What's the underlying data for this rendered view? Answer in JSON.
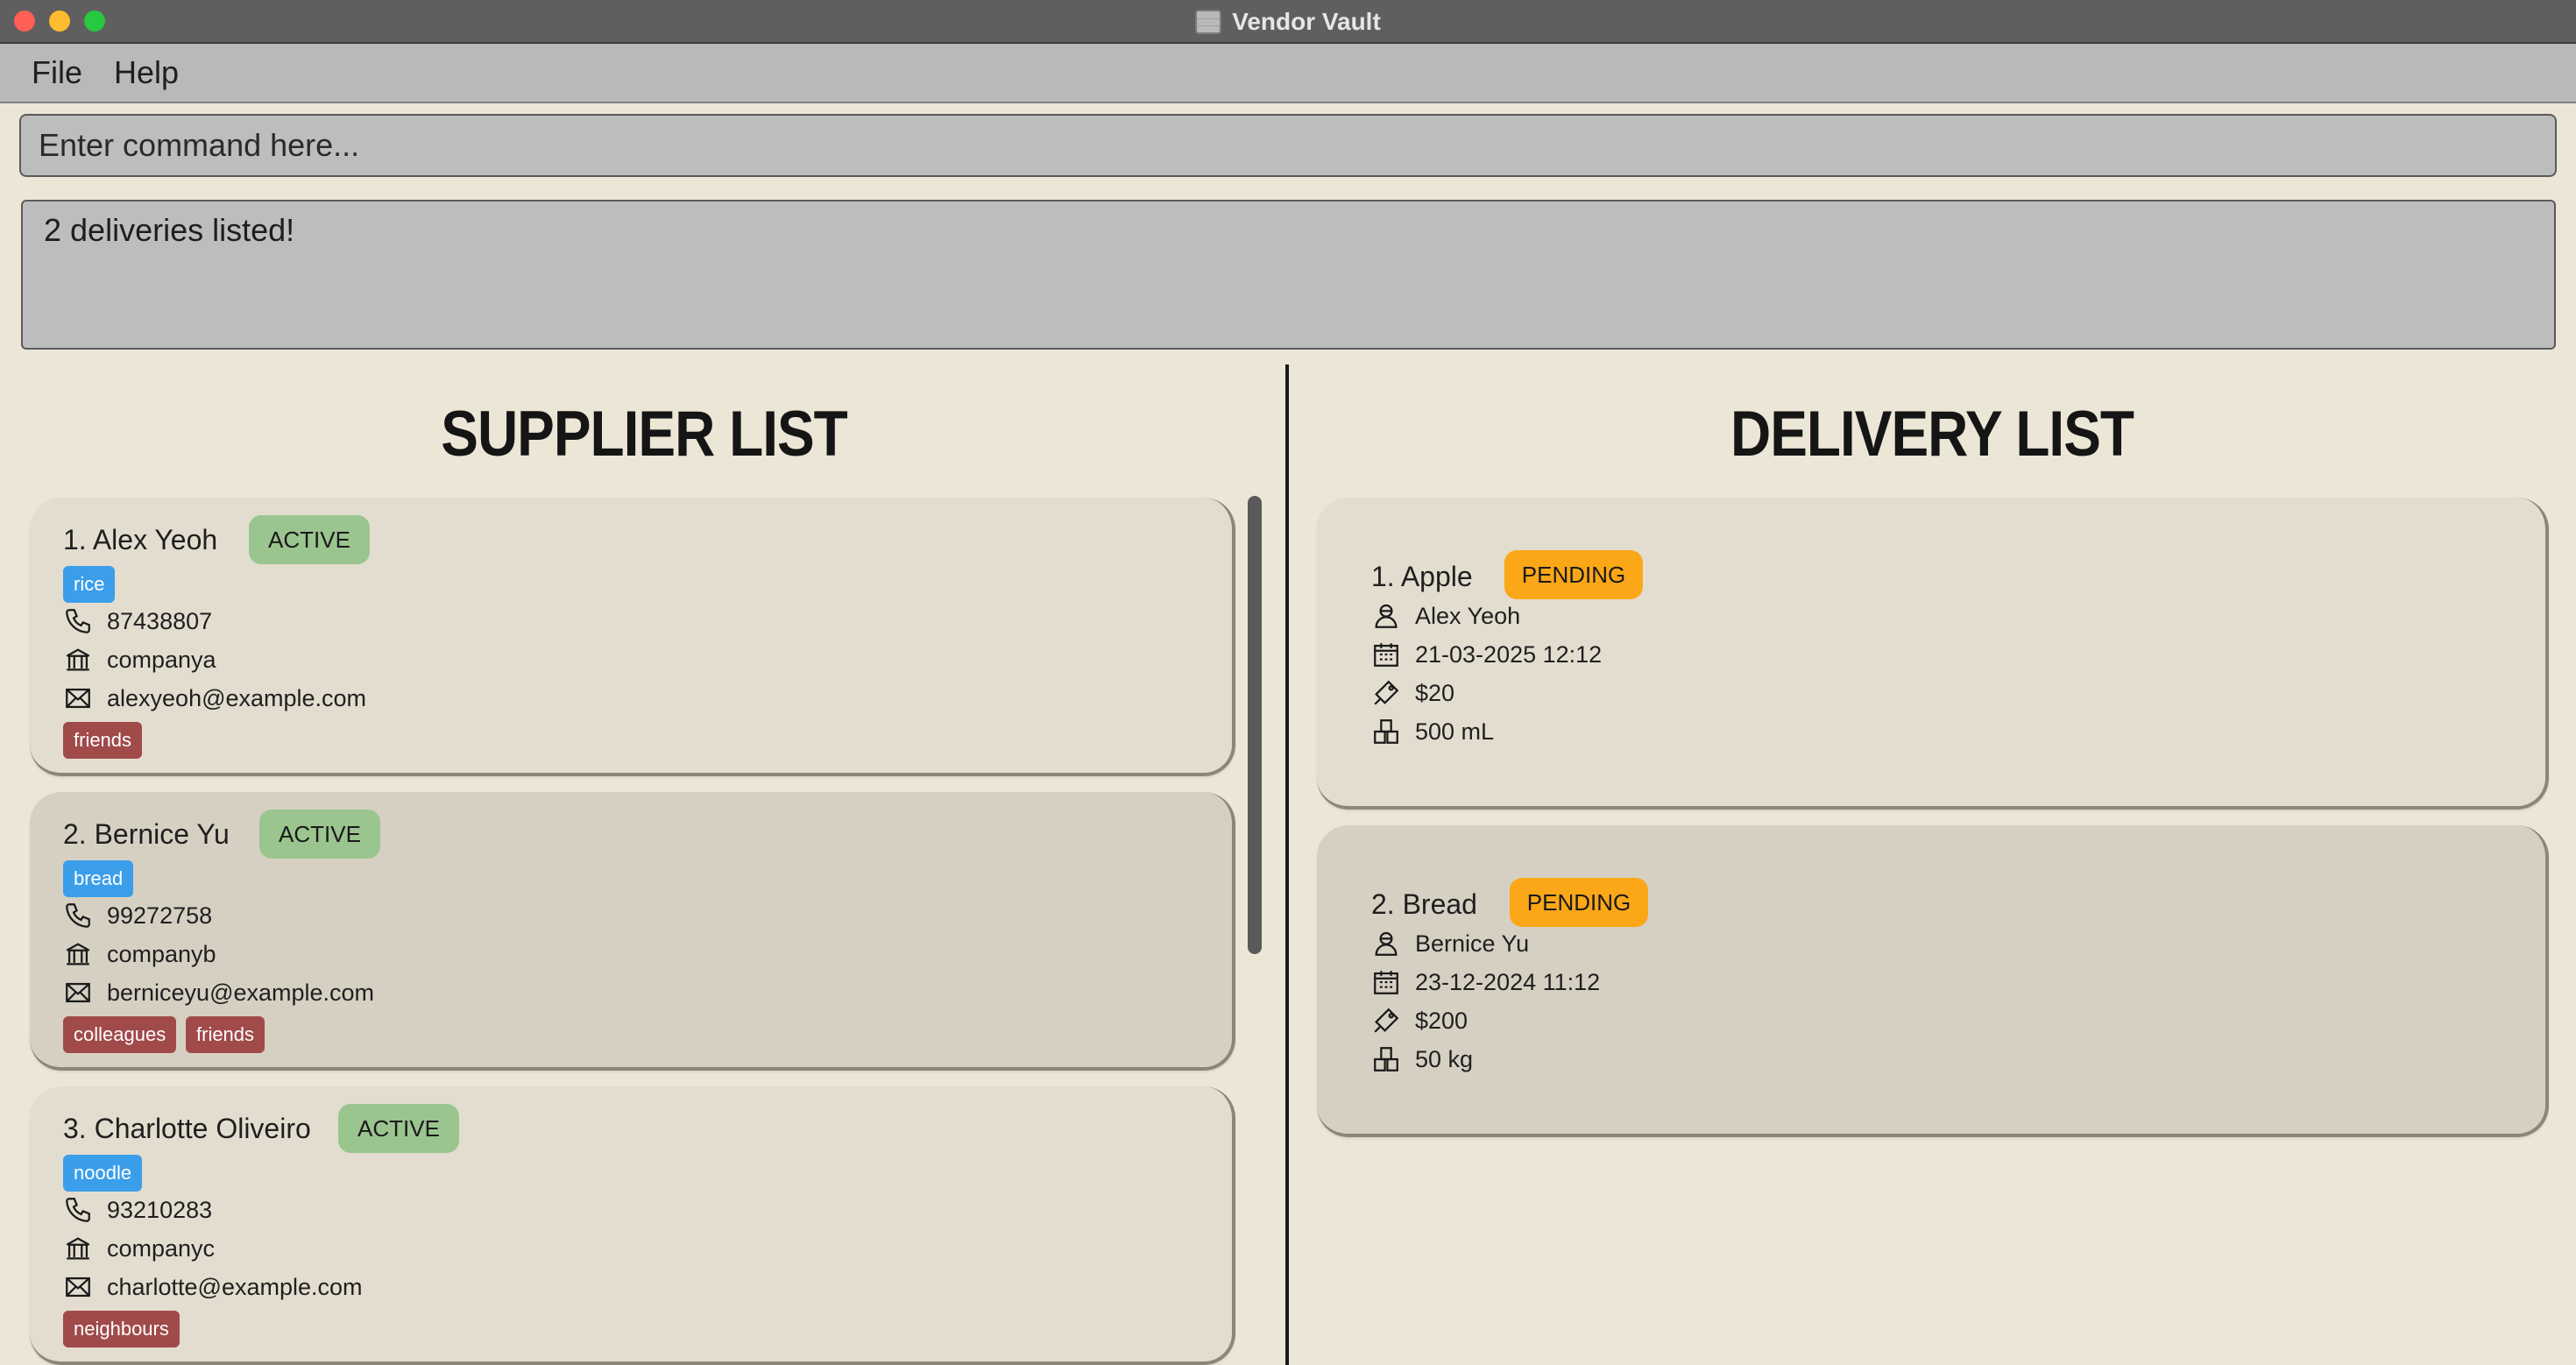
{
  "window": {
    "title": "Vendor Vault"
  },
  "menu": {
    "file": "File",
    "help": "Help"
  },
  "command": {
    "placeholder": "Enter command here..."
  },
  "result": {
    "message": "2 deliveries listed!"
  },
  "headings": {
    "supplier": "SUPPLIER LIST",
    "delivery": "DELIVERY LIST"
  },
  "suppliers": [
    {
      "name": "1. Alex Yeoh",
      "status": "ACTIVE",
      "product": "rice",
      "phone": "87438807",
      "company": "companya",
      "email": "alexyeoh@example.com",
      "tags": [
        "friends"
      ]
    },
    {
      "name": "2. Bernice Yu",
      "status": "ACTIVE",
      "product": "bread",
      "phone": "99272758",
      "company": "companyb",
      "email": "berniceyu@example.com",
      "tags": [
        "colleagues",
        "friends"
      ]
    },
    {
      "name": "3. Charlotte Oliveiro",
      "status": "ACTIVE",
      "product": "noodle",
      "phone": "93210283",
      "company": "companyc",
      "email": "charlotte@example.com",
      "tags": [
        "neighbours"
      ]
    }
  ],
  "deliveries": [
    {
      "name": "1. Apple",
      "status": "PENDING",
      "supplier": "Alex Yeoh",
      "date": "21-03-2025 12:12",
      "cost": "$20",
      "quantity": "500 mL"
    },
    {
      "name": "2. Bread",
      "status": "PENDING",
      "supplier": "Bernice Yu",
      "date": "23-12-2024 11:12",
      "cost": "$200",
      "quantity": "50 kg"
    }
  ],
  "colors": {
    "background": "#ece6d7",
    "active": "#9bc58f",
    "pending": "#fba718",
    "product_tag": "#3a9eea",
    "tag": "#a14a4a"
  },
  "icons": [
    "phone-icon",
    "building-icon",
    "mail-icon",
    "person-icon",
    "calendar-icon",
    "price-tag-icon",
    "boxes-icon"
  ]
}
